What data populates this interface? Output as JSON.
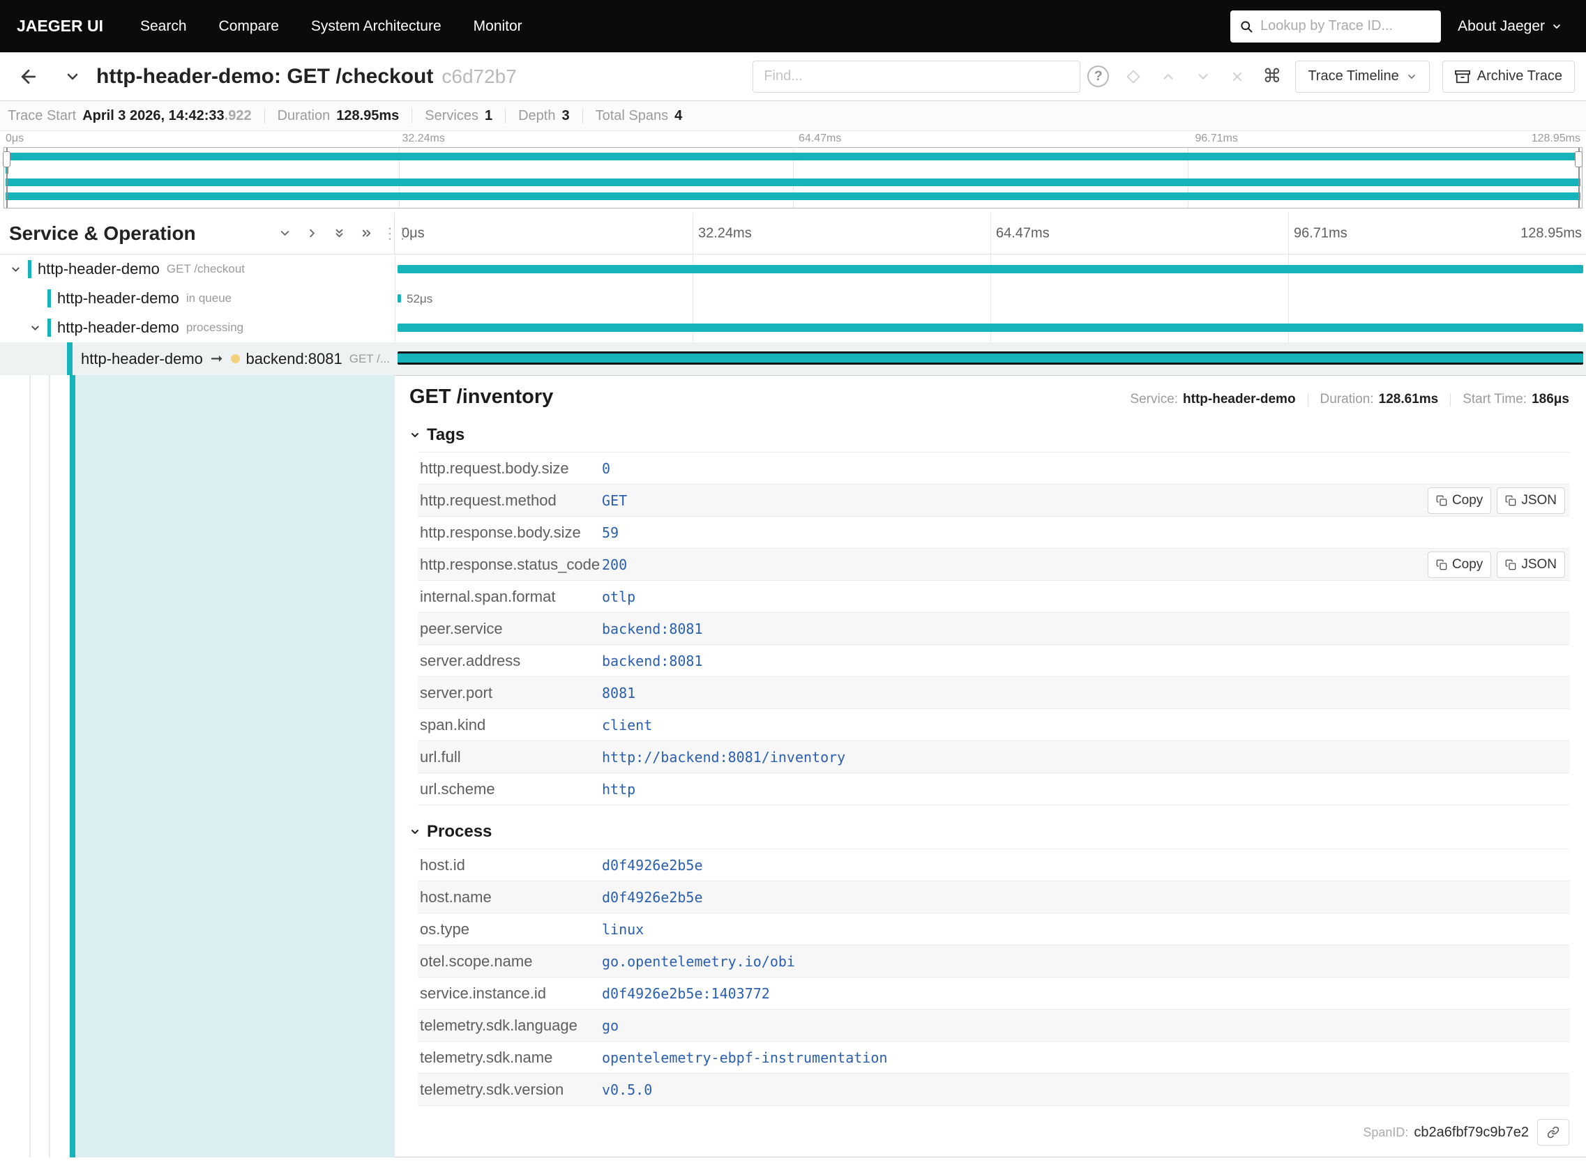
{
  "colors": {
    "accent": "#17b3ba",
    "nav_bg": "#0b0b0b",
    "value_blue": "#2a5faf",
    "selected_row_bg": "#eff2f3",
    "detail_fill": "#dbeff1",
    "peer_dot": "#f2d07c"
  },
  "nav": {
    "brand": "JAEGER UI",
    "items": [
      "Search",
      "Compare",
      "System Architecture",
      "Monitor"
    ],
    "lookup_placeholder": "Lookup by Trace ID...",
    "about_label": "About Jaeger"
  },
  "trace_header": {
    "title": "http-header-demo: GET /checkout",
    "trace_id": "c6d72b7",
    "find_placeholder": "Find...",
    "help": "?",
    "view_button": "Trace Timeline",
    "archive_button": "Archive Trace"
  },
  "summary": {
    "items": [
      {
        "label": "Trace Start",
        "value": "April 3 2026, 14:42:33",
        "frac": ".922"
      },
      {
        "label": "Duration",
        "value": "128.95ms"
      },
      {
        "label": "Services",
        "value": "1"
      },
      {
        "label": "Depth",
        "value": "3"
      },
      {
        "label": "Total Spans",
        "value": "4"
      }
    ]
  },
  "timeline": {
    "left_header": "Service & Operation",
    "ticks": [
      "0μs",
      "32.24ms",
      "64.47ms",
      "96.71ms",
      "128.95ms"
    ],
    "rows": [
      {
        "service": "http-header-demo",
        "operation": "GET /checkout"
      },
      {
        "service": "http-header-demo",
        "operation": "in queue",
        "duration_label": "52μs"
      },
      {
        "service": "http-header-demo",
        "operation": "processing"
      },
      {
        "service": "http-header-demo",
        "peer": "backend:8081",
        "operation": "GET /..."
      }
    ]
  },
  "detail": {
    "title": "GET /inventory",
    "meta": [
      {
        "label": "Service:",
        "value": "http-header-demo"
      },
      {
        "label": "Duration:",
        "value": "128.61ms"
      },
      {
        "label": "Start Time:",
        "value": "186μs"
      }
    ],
    "tags_label": "Tags",
    "tags": [
      {
        "key": "http.request.body.size",
        "value": "0"
      },
      {
        "key": "http.request.method",
        "value": "GET"
      },
      {
        "key": "http.response.body.size",
        "value": "59"
      },
      {
        "key": "http.response.status_code",
        "value": "200"
      },
      {
        "key": "internal.span.format",
        "value": "otlp"
      },
      {
        "key": "peer.service",
        "value": "backend:8081"
      },
      {
        "key": "server.address",
        "value": "backend:8081"
      },
      {
        "key": "server.port",
        "value": "8081"
      },
      {
        "key": "span.kind",
        "value": "client"
      },
      {
        "key": "url.full",
        "value": "http://backend:8081/inventory"
      },
      {
        "key": "url.scheme",
        "value": "http"
      }
    ],
    "process_label": "Process",
    "process": [
      {
        "key": "host.id",
        "value": "d0f4926e2b5e"
      },
      {
        "key": "host.name",
        "value": "d0f4926e2b5e"
      },
      {
        "key": "os.type",
        "value": "linux"
      },
      {
        "key": "otel.scope.name",
        "value": "go.opentelemetry.io/obi"
      },
      {
        "key": "service.instance.id",
        "value": "d0f4926e2b5e:1403772"
      },
      {
        "key": "telemetry.sdk.language",
        "value": "go"
      },
      {
        "key": "telemetry.sdk.name",
        "value": "opentelemetry-ebpf-instrumentation"
      },
      {
        "key": "telemetry.sdk.version",
        "value": "v0.5.0"
      }
    ],
    "copy_label": "Copy",
    "json_label": "JSON",
    "spanid_label": "SpanID:",
    "spanid": "cb2a6fbf79c9b7e2"
  }
}
